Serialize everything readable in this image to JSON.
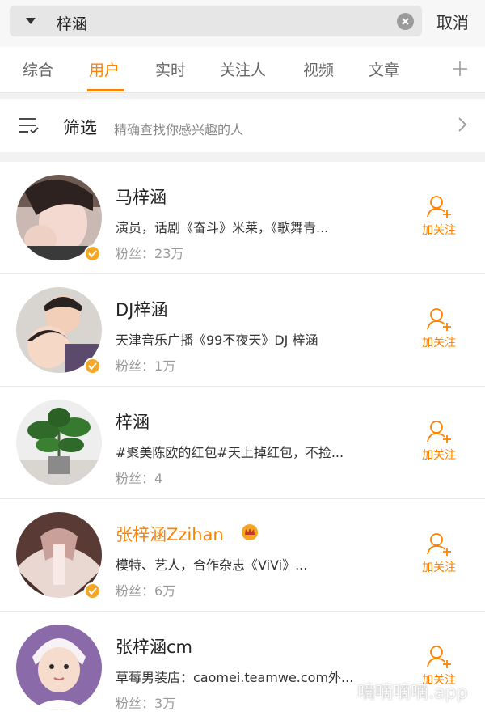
{
  "search": {
    "query": "梓涵",
    "cancel_label": "取消"
  },
  "tabs": [
    {
      "label": "综合"
    },
    {
      "label": "用户",
      "active": true
    },
    {
      "label": "实时"
    },
    {
      "label": "关注人"
    },
    {
      "label": "视频"
    },
    {
      "label": "文章"
    }
  ],
  "filter": {
    "title": "筛选",
    "description": "精确查找你感兴趣的人"
  },
  "users": [
    {
      "name": "马梓涵",
      "description": "演员，话剧《奋斗》米莱，《歌舞青...",
      "fans_label": "粉丝：",
      "fans": "23万",
      "verified": true
    },
    {
      "name": "DJ梓涵",
      "description": "天津音乐广播《99不夜天》DJ 梓涵",
      "fans_label": "粉丝：",
      "fans": "1万",
      "verified": true
    },
    {
      "name": "梓涵",
      "description": "#聚美陈欧的红包#天上掉红包，不捡...",
      "fans_label": "粉丝：",
      "fans": "4",
      "verified": false
    },
    {
      "name": "张梓涵Zzihan",
      "description": "模特、艺人，合作杂志《ViVi》...",
      "fans_label": "粉丝：",
      "fans": "6万",
      "verified": true,
      "vip": true
    },
    {
      "name": "张梓涵cm",
      "description": "草莓男装店：caomei.teamwe.com外...",
      "fans_label": "粉丝：",
      "fans": "3万",
      "verified": false
    }
  ],
  "follow_label": "加关注",
  "watermark": "嘀嘀嘀嘀.app",
  "colors": {
    "accent": "#ff8200",
    "badge": "#f5a623"
  }
}
